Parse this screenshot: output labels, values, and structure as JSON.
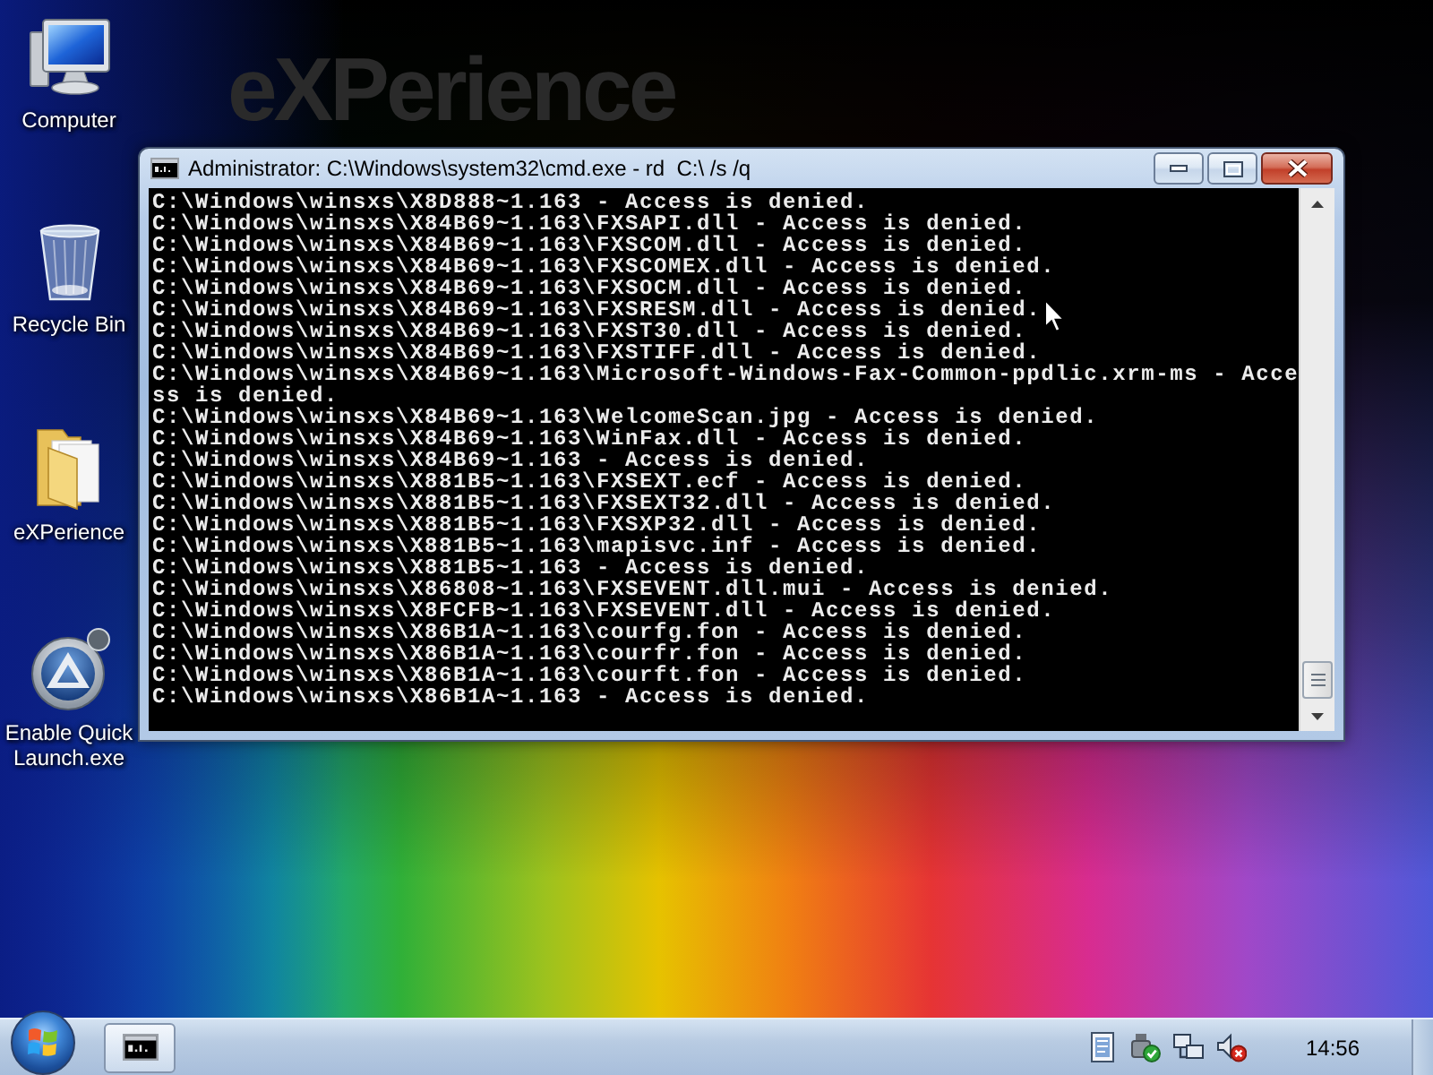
{
  "desktop": {
    "wallpaper_text": "eXPerience",
    "icons": [
      {
        "kind": "computer",
        "label": "Computer"
      },
      {
        "kind": "recycle-bin",
        "label": "Recycle Bin"
      },
      {
        "kind": "folder",
        "label": "eXPerience"
      },
      {
        "kind": "app",
        "label": "Enable Quick Launch.exe"
      }
    ]
  },
  "window": {
    "title": "Administrator: C:\\Windows\\system32\\cmd.exe - rd  C:\\ /s /q",
    "console_lines": [
      "C:\\Windows\\winsxs\\X8D888~1.163 - Access is denied.",
      "C:\\Windows\\winsxs\\X84B69~1.163\\FXSAPI.dll - Access is denied.",
      "C:\\Windows\\winsxs\\X84B69~1.163\\FXSCOM.dll - Access is denied.",
      "C:\\Windows\\winsxs\\X84B69~1.163\\FXSCOMEX.dll - Access is denied.",
      "C:\\Windows\\winsxs\\X84B69~1.163\\FXSOCM.dll - Access is denied.",
      "C:\\Windows\\winsxs\\X84B69~1.163\\FXSRESM.dll - Access is denied.",
      "C:\\Windows\\winsxs\\X84B69~1.163\\FXST30.dll - Access is denied.",
      "C:\\Windows\\winsxs\\X84B69~1.163\\FXSTIFF.dll - Access is denied.",
      "C:\\Windows\\winsxs\\X84B69~1.163\\Microsoft-Windows-Fax-Common-ppdlic.xrm-ms - Acce",
      "ss is denied.",
      "C:\\Windows\\winsxs\\X84B69~1.163\\WelcomeScan.jpg - Access is denied.",
      "C:\\Windows\\winsxs\\X84B69~1.163\\WinFax.dll - Access is denied.",
      "C:\\Windows\\winsxs\\X84B69~1.163 - Access is denied.",
      "C:\\Windows\\winsxs\\X881B5~1.163\\FXSEXT.ecf - Access is denied.",
      "C:\\Windows\\winsxs\\X881B5~1.163\\FXSEXT32.dll - Access is denied.",
      "C:\\Windows\\winsxs\\X881B5~1.163\\FXSXP32.dll - Access is denied.",
      "C:\\Windows\\winsxs\\X881B5~1.163\\mapisvc.inf - Access is denied.",
      "C:\\Windows\\winsxs\\X881B5~1.163 - Access is denied.",
      "C:\\Windows\\winsxs\\X86808~1.163\\FXSEVENT.dll.mui - Access is denied.",
      "C:\\Windows\\winsxs\\X8FCFB~1.163\\FXSEVENT.dll - Access is denied.",
      "C:\\Windows\\winsxs\\X86B1A~1.163\\courfg.fon - Access is denied.",
      "C:\\Windows\\winsxs\\X86B1A~1.163\\courfr.fon - Access is denied.",
      "C:\\Windows\\winsxs\\X86B1A~1.163\\courft.fon - Access is denied.",
      "C:\\Windows\\winsxs\\X86B1A~1.163 - Access is denied."
    ]
  },
  "taskbar": {
    "clock": "14:56"
  }
}
